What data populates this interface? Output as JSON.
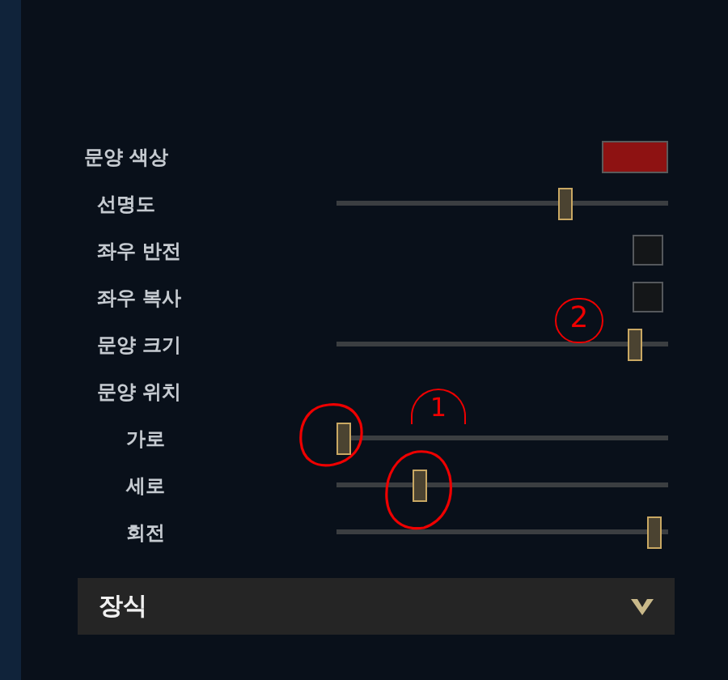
{
  "settings": [
    {
      "kind": "color",
      "label": "문양 색상",
      "color": "#8e1212"
    },
    {
      "kind": "slider",
      "label": "선명도",
      "level": 0.7
    },
    {
      "kind": "checkbox",
      "label": "좌우 반전",
      "checked": false
    },
    {
      "kind": "checkbox",
      "label": "좌우 복사",
      "checked": false
    },
    {
      "kind": "slider",
      "label": "문양 크기",
      "level": 0.92
    },
    {
      "kind": "group",
      "label": "문양 위치",
      "children": [
        {
          "kind": "slider",
          "label": "가로",
          "level": 0.0
        },
        {
          "kind": "slider",
          "label": "세로",
          "level": 0.24
        },
        {
          "kind": "slider",
          "label": "회전",
          "level": 0.98
        }
      ]
    }
  ],
  "section": {
    "label": "장식",
    "expanded": false
  },
  "annotations": [
    {
      "label": "2"
    },
    {
      "label": "1"
    }
  ]
}
